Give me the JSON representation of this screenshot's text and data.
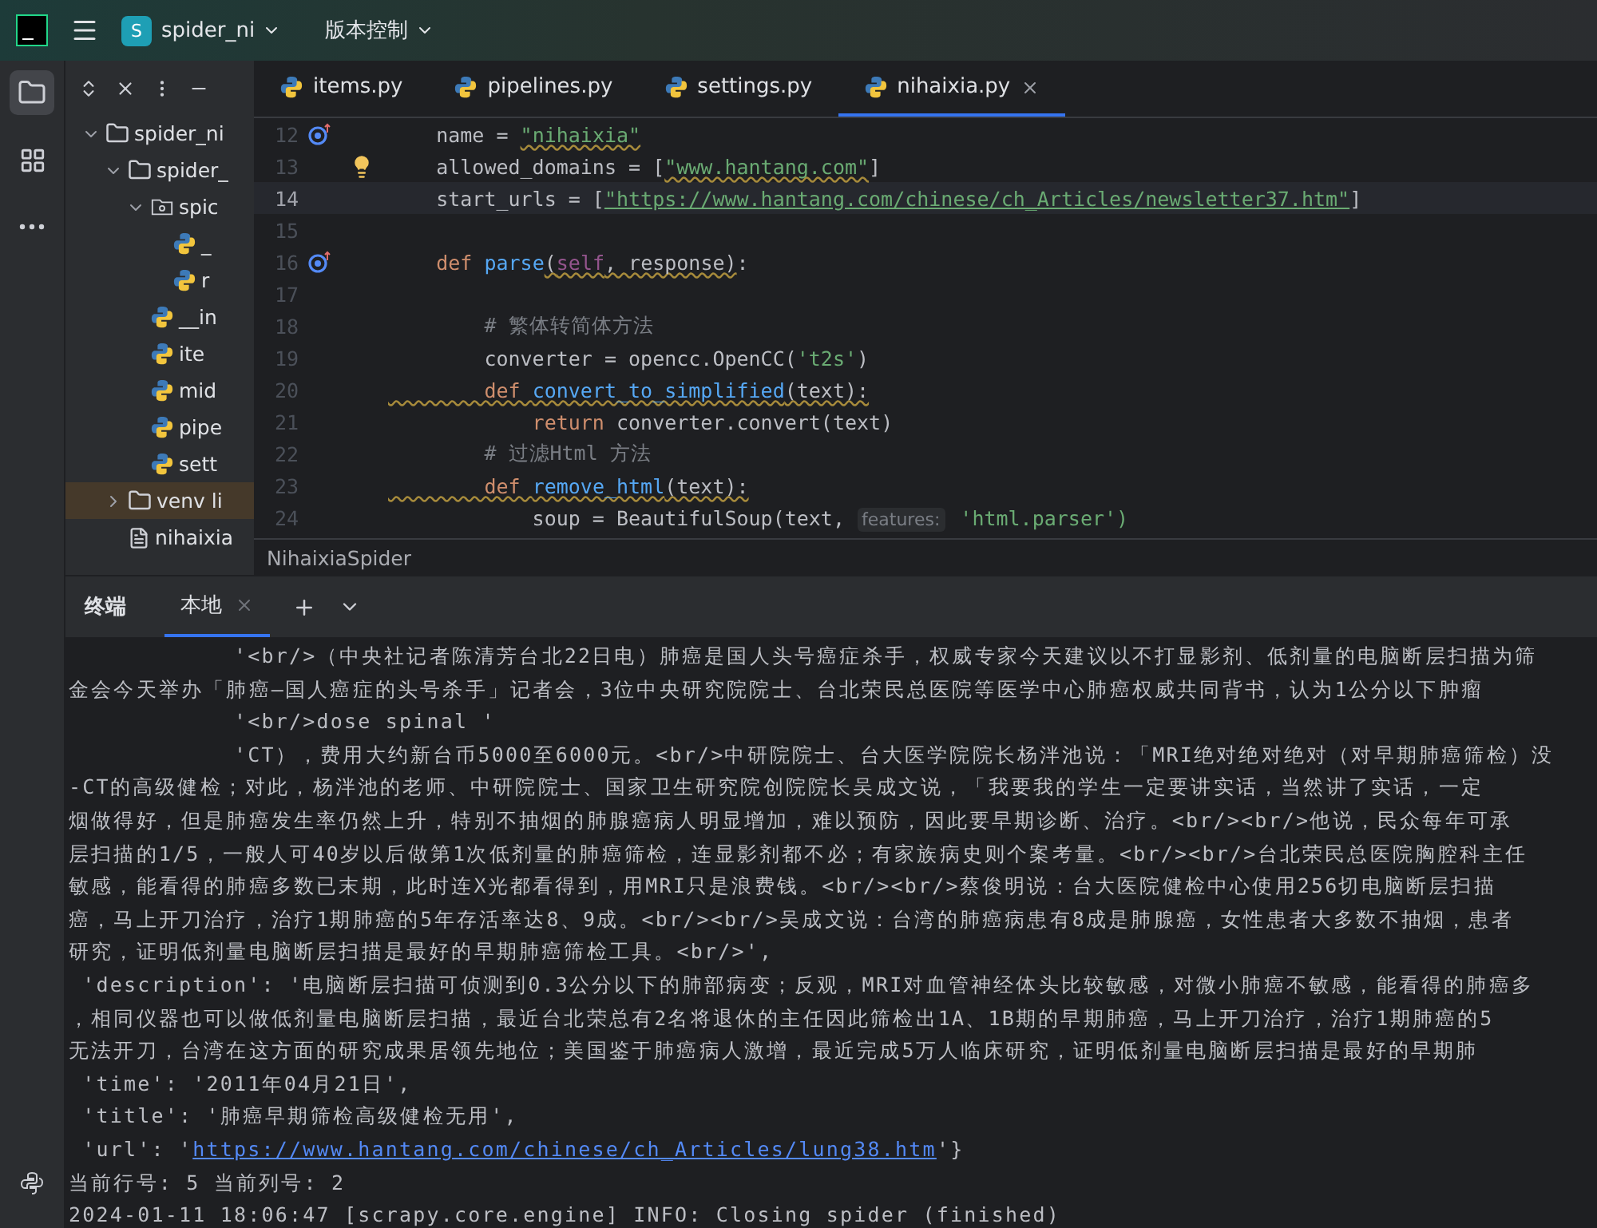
{
  "title_bar": {
    "project_badge": "S",
    "project": "spider_ni",
    "vcs": "版本控制"
  },
  "project_tree": [
    {
      "label": "spider_ni",
      "kind": "folder",
      "expanded": true,
      "selected": false,
      "children": [
        {
          "label": "spider_",
          "kind": "folder",
          "expanded": true,
          "selected": false,
          "children": [
            {
              "label": "spic",
              "kind": "package",
              "expanded": true,
              "selected": false,
              "children": [
                {
                  "label": "_",
                  "kind": "python",
                  "selected": false
                },
                {
                  "label": "r",
                  "kind": "python",
                  "selected": false
                }
              ]
            },
            {
              "label": "__in",
              "kind": "python",
              "selected": false
            },
            {
              "label": "ite",
              "kind": "python",
              "selected": false
            },
            {
              "label": "mid",
              "kind": "python",
              "selected": false
            },
            {
              "label": "pipe",
              "kind": "python",
              "selected": false
            },
            {
              "label": "sett",
              "kind": "python",
              "selected": false
            }
          ]
        },
        {
          "label": "venv li",
          "kind": "folder",
          "expanded": false,
          "selected": true
        },
        {
          "label": "nihaixia",
          "kind": "text",
          "selected": false
        }
      ]
    }
  ],
  "editor_tabs": [
    {
      "label": "items.py",
      "selected": false
    },
    {
      "label": "pipelines.py",
      "selected": false
    },
    {
      "label": "settings.py",
      "selected": false
    },
    {
      "label": "nihaixia.py",
      "selected": true
    }
  ],
  "code_lines": [
    {
      "number": "12",
      "gutter": [
        {
          "kind": "override"
        }
      ],
      "current": false,
      "tokens": [
        {
          "kind": "plain",
          "text": "    name = "
        },
        {
          "kind": "string",
          "text": "\"nihaixia\"",
          "wavy": true
        }
      ]
    },
    {
      "number": "13",
      "gutter": [
        {
          "kind": "bulb"
        }
      ],
      "current": false,
      "tokens": [
        {
          "kind": "plain",
          "text": "    allowed_domains = ["
        },
        {
          "kind": "string",
          "text": "\"www.hantang.com\"",
          "wavy": true
        },
        {
          "kind": "plain",
          "text": "]"
        }
      ]
    },
    {
      "number": "14",
      "current": true,
      "tokens": [
        {
          "kind": "plain",
          "text": "    start_urls = ["
        },
        {
          "kind": "url",
          "text": "\"https://www.hantang.com/chinese/ch_Articles/newsletter37.htm\""
        },
        {
          "kind": "plain",
          "text": "]"
        }
      ]
    },
    {
      "number": "15",
      "current": false
    },
    {
      "number": "16",
      "gutter": [
        {
          "kind": "override"
        }
      ],
      "current": false,
      "tokens": [
        {
          "kind": "keyword",
          "text": "    def "
        },
        {
          "kind": "fn",
          "text": "parse"
        },
        {
          "kind": "plain",
          "text": "(",
          "wavy": true
        },
        {
          "kind": "self",
          "text": "self",
          "wavy": true
        },
        {
          "kind": "plain",
          "text": ", response)",
          "wavy": true
        },
        {
          "kind": "plain",
          "text": ":"
        }
      ]
    },
    {
      "number": "17",
      "current": false
    },
    {
      "number": "18",
      "current": false,
      "tokens": [
        {
          "kind": "comment",
          "text": "        # 繁体转简体方法"
        }
      ]
    },
    {
      "number": "19",
      "current": false,
      "tokens": [
        {
          "kind": "plain",
          "text": "        converter = opencc.OpenCC("
        },
        {
          "kind": "string",
          "text": "'t2s'"
        },
        {
          "kind": "plain",
          "text": ")"
        }
      ]
    },
    {
      "number": "20",
      "current": false,
      "tokens": [
        {
          "kind": "keyword",
          "text": "        def ",
          "wavy": true
        },
        {
          "kind": "fn",
          "text": "convert_to_simplified",
          "wavy": true
        },
        {
          "kind": "plain",
          "text": "(text):",
          "wavy": true
        }
      ]
    },
    {
      "number": "21",
      "current": false,
      "tokens": [
        {
          "kind": "keyword",
          "text": "            return "
        },
        {
          "kind": "plain",
          "text": "converter.convert(text)"
        }
      ]
    },
    {
      "number": "22",
      "current": false,
      "tokens": [
        {
          "kind": "comment",
          "text": "        # 过滤Html 方法"
        }
      ]
    },
    {
      "number": "23",
      "current": false,
      "tokens": [
        {
          "kind": "keyword",
          "text": "        def ",
          "wavy": true
        },
        {
          "kind": "fn",
          "text": "remove_html",
          "wavy": true
        },
        {
          "kind": "plain",
          "text": "(text):",
          "wavy": true
        }
      ]
    },
    {
      "number": "24",
      "current": false,
      "tokens": [
        {
          "kind": "plain",
          "text": "            soup = BeautifulSoup(text, "
        },
        {
          "kind": "hint",
          "text": "features:"
        },
        {
          "kind": "string",
          "text": " 'html.parser')"
        }
      ]
    }
  ],
  "breadcrumb": "NihaixiaSpider",
  "terminal": {
    "title": "终端",
    "tabs": [
      {
        "label": "本地",
        "selected": true
      }
    ],
    "lines": [
      {
        "kind": "text",
        "text": "            '<br/>（中央社记者陈清芳台北22日电）肺癌是国人头号癌症杀手，权威专家今天建议以不打显影剂、低剂量的电脑断层扫描为筛"
      },
      {
        "kind": "text",
        "text": "金会今天举办「肺癌—国人癌症的头号杀手」记者会，3位中央研究院院士、台北荣民总医院等医学中心肺癌权威共同背书，认为1公分以下肿瘤"
      },
      {
        "kind": "text",
        "text": "            '<br/>dose spinal '"
      },
      {
        "kind": "text",
        "text": "            'CT），费用大约新台币5000至6000元。<br/>中研院院士、台大医学院院长杨泮池说：「MRI绝对绝对绝对（对早期肺癌筛检）没"
      },
      {
        "kind": "text",
        "text": "-CT的高级健检；对此，杨泮池的老师、中研院院士、国家卫生研究院创院院长吴成文说，「我要我的学生一定要讲实话，当然讲了实话，一定"
      },
      {
        "kind": "text",
        "text": "烟做得好，但是肺癌发生率仍然上升，特别不抽烟的肺腺癌病人明显增加，难以预防，因此要早期诊断、治疗。<br/><br/>他说，民众每年可承"
      },
      {
        "kind": "text",
        "text": "层扫描的1/5，一般人可40岁以后做第1次低剂量的肺癌筛检，连显影剂都不必；有家族病史则个案考量。<br/><br/>台北荣民总医院胸腔科主任"
      },
      {
        "kind": "text",
        "text": "敏感，能看得的肺癌多数已末期，此时连X光都看得到，用MRI只是浪费钱。<br/><br/>蔡俊明说：台大医院健检中心使用256切电脑断层扫描"
      },
      {
        "kind": "text",
        "text": "癌，马上开刀治疗，治疗1期肺癌的5年存活率达8、9成。<br/><br/>吴成文说：台湾的肺癌病患有8成是肺腺癌，女性患者大多数不抽烟，患者"
      },
      {
        "kind": "text",
        "text": "研究，证明低剂量电脑断层扫描是最好的早期肺癌筛检工具。<br/>',"
      },
      {
        "kind": "text",
        "text": " 'description': '电脑断层扫描可侦测到0.3公分以下的肺部病变；反观，MRI对血管神经体头比较敏感，对微小肺癌不敏感，能看得的肺癌多"
      },
      {
        "kind": "text",
        "text": "，相同仪器也可以做低剂量电脑断层扫描，最近台北荣总有2名将退休的主任因此筛检出1A、1B期的早期肺癌，马上开刀治疗，治疗1期肺癌的5"
      },
      {
        "kind": "text",
        "text": "无法开刀，台湾在这方面的研究成果居领先地位；美国鉴于肺癌病人激增，最近完成5万人临床研究，证明低剂量电脑断层扫描是最好的早期肺"
      },
      {
        "kind": "text",
        "text": " 'time': '2011年04月21日',"
      },
      {
        "kind": "text",
        "text": " 'title': '肺癌早期筛检高级健检无用',"
      },
      {
        "kind": "link",
        "prefix": " 'url': '",
        "link": "https://www.hantang.com/chinese/ch_Articles/lung38.htm",
        "suffix": "'}"
      },
      {
        "kind": "text",
        "text": "当前行号: 5 当前列号: 2"
      },
      {
        "kind": "text",
        "text": "2024-01-11 18:06:47 [scrapy.core.engine] INFO: Closing spider (finished)"
      }
    ]
  }
}
